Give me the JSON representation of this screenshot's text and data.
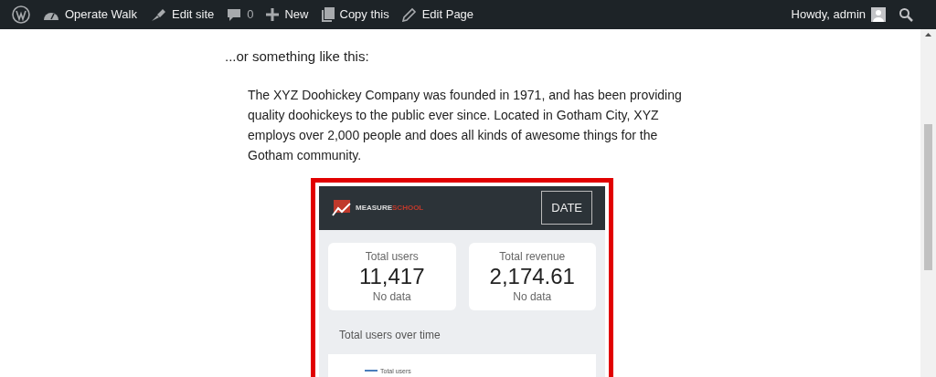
{
  "admin_bar": {
    "items": [
      {
        "kind": "logo"
      },
      {
        "kind": "dashboard",
        "label": "Operate Walk"
      },
      {
        "kind": "edit-site",
        "label": "Edit site"
      },
      {
        "kind": "comments",
        "label": "0"
      },
      {
        "kind": "new",
        "label": "New"
      },
      {
        "kind": "copy",
        "label": "Copy this"
      },
      {
        "kind": "edit",
        "label": "Edit Page"
      }
    ],
    "greeting": "Howdy, admin"
  },
  "content": {
    "intro": "...or something like this:",
    "quote": "The XYZ Doohickey Company was founded in 1971, and has been providing quality doohickeys to the public ever since. Located in Gotham City, XYZ employs over 2,000 people and does all kinds of awesome things for the Gotham community."
  },
  "dashboard": {
    "logo_text": "MEASURE",
    "logo_accent": "SCHOOL",
    "date_button": "DATE",
    "scorecards": [
      {
        "label": "Total users",
        "value": "11,417",
        "note": "No data"
      },
      {
        "label": "Total revenue",
        "value": "2,174.61",
        "note": "No data"
      }
    ],
    "chart_title": "Total users over time",
    "legend": "Total users"
  }
}
